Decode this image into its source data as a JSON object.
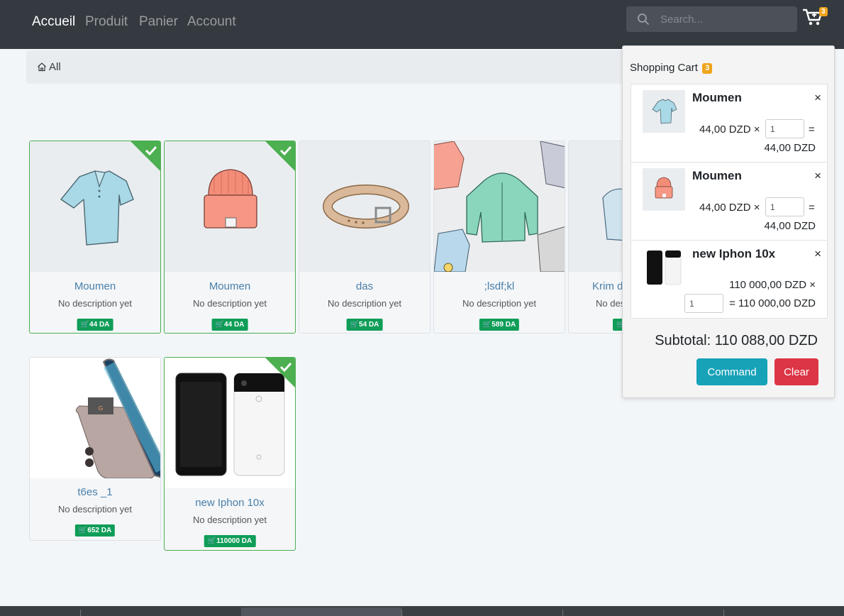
{
  "nav": {
    "links": [
      "Accueil",
      "Produit",
      "Panier",
      "Account"
    ],
    "search_placeholder": "Search...",
    "cart_count": "3"
  },
  "breadcrumb": {
    "label": "All"
  },
  "products": [
    {
      "title": "Moumen",
      "desc": "No description yet",
      "price": "44 DA",
      "selected": true,
      "image": "polo-shirt"
    },
    {
      "title": "Moumen",
      "desc": "No description yet",
      "price": "44 DA",
      "selected": true,
      "image": "beanie"
    },
    {
      "title": "das",
      "desc": "No description yet",
      "price": "54 DA",
      "selected": false,
      "image": "belt"
    },
    {
      "title": ";lsdf;kl",
      "desc": "No description yet",
      "price": "589 DA",
      "selected": false,
      "image": "hoodies"
    },
    {
      "title": "Krim d",
      "desc": "No descr",
      "price": "",
      "selected": false,
      "image": "hoodie"
    },
    {
      "title": "t6es _1",
      "desc": "No description yet",
      "price": "652 DA",
      "selected": false,
      "image": "gionee-phone"
    },
    {
      "title": "new Iphon 10x",
      "desc": "No description yet",
      "price": "110000 DA",
      "selected": true,
      "image": "pixel-phones"
    }
  ],
  "cart": {
    "heading": "Shopping Cart",
    "count": "3",
    "items": [
      {
        "name": "Moumen",
        "unit_price": "44,00 DZD",
        "times": "×",
        "qty": "1",
        "equals": "=",
        "total": "44,00 DZD",
        "remove": "×"
      },
      {
        "name": "Moumen",
        "unit_price": "44,00 DZD",
        "times": "×",
        "qty": "1",
        "equals": "=",
        "total": "44,00 DZD",
        "remove": "×"
      },
      {
        "name": "new Iphon 10x",
        "unit_price": "110 000,00 DZD",
        "times": "×",
        "qty": "1",
        "equals": "=",
        "total": "110 000,00 DZD",
        "remove": "×"
      }
    ],
    "subtotal": "Subtotal: 110 088,00 DZD",
    "command_label": "Command",
    "clear_label": "Clear"
  },
  "colors": {
    "navbar": "#343a40",
    "badge": "#f0a41c",
    "price_badge": "#0f9d58",
    "selected_border": "#4caf50",
    "command": "#17a2b8",
    "clear": "#dc3545",
    "link": "#4a7fa8"
  }
}
